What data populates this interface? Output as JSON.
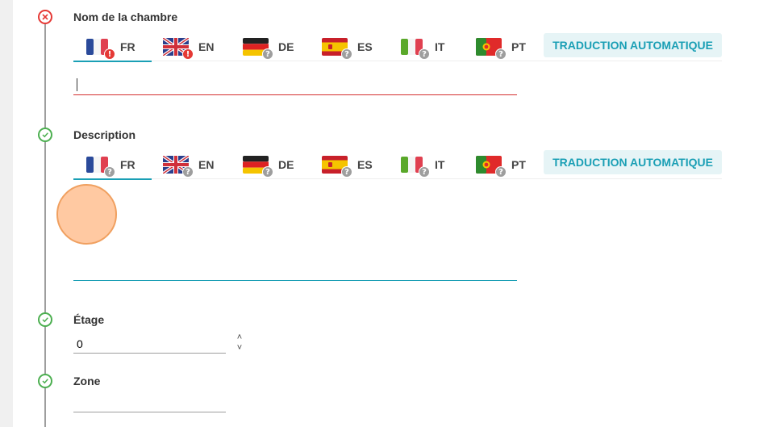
{
  "fields": {
    "name": {
      "label": "Nom de la chambre",
      "status": "error",
      "value": "",
      "auto_translate_label": "TRADUCTION AUTOMATIQUE",
      "languages": [
        {
          "code": "FR",
          "flag": "fr-flag-icon",
          "state": "warning",
          "active": true
        },
        {
          "code": "EN",
          "flag": "uk-flag-icon",
          "state": "warning",
          "active": false
        },
        {
          "code": "DE",
          "flag": "de-flag-icon",
          "state": "unknown",
          "active": false
        },
        {
          "code": "ES",
          "flag": "es-flag-icon",
          "state": "unknown",
          "active": false
        },
        {
          "code": "IT",
          "flag": "it-flag-icon",
          "state": "unknown",
          "active": false
        },
        {
          "code": "PT",
          "flag": "pt-flag-icon",
          "state": "unknown",
          "active": false
        }
      ]
    },
    "description": {
      "label": "Description",
      "status": "valid",
      "value": "",
      "auto_translate_label": "TRADUCTION AUTOMATIQUE",
      "languages": [
        {
          "code": "FR",
          "flag": "fr-flag-icon",
          "state": "unknown",
          "active": true
        },
        {
          "code": "EN",
          "flag": "uk-flag-icon",
          "state": "unknown",
          "active": false
        },
        {
          "code": "DE",
          "flag": "de-flag-icon",
          "state": "unknown",
          "active": false
        },
        {
          "code": "ES",
          "flag": "es-flag-icon",
          "state": "unknown",
          "active": false
        },
        {
          "code": "IT",
          "flag": "it-flag-icon",
          "state": "unknown",
          "active": false
        },
        {
          "code": "PT",
          "flag": "pt-flag-icon",
          "state": "unknown",
          "active": false
        }
      ]
    },
    "floor": {
      "label": "Étage",
      "status": "valid",
      "value": "0"
    },
    "zone": {
      "label": "Zone",
      "status": "valid",
      "value": ""
    }
  },
  "badges": {
    "warning_glyph": "!",
    "unknown_glyph": "?"
  },
  "spinner": {
    "up_glyph": "˄",
    "down_glyph": "˅"
  },
  "colors": {
    "accent": "#1a9fb5",
    "error": "#e53935",
    "valid": "#4caf50",
    "error_underline": "#d32f2f"
  }
}
